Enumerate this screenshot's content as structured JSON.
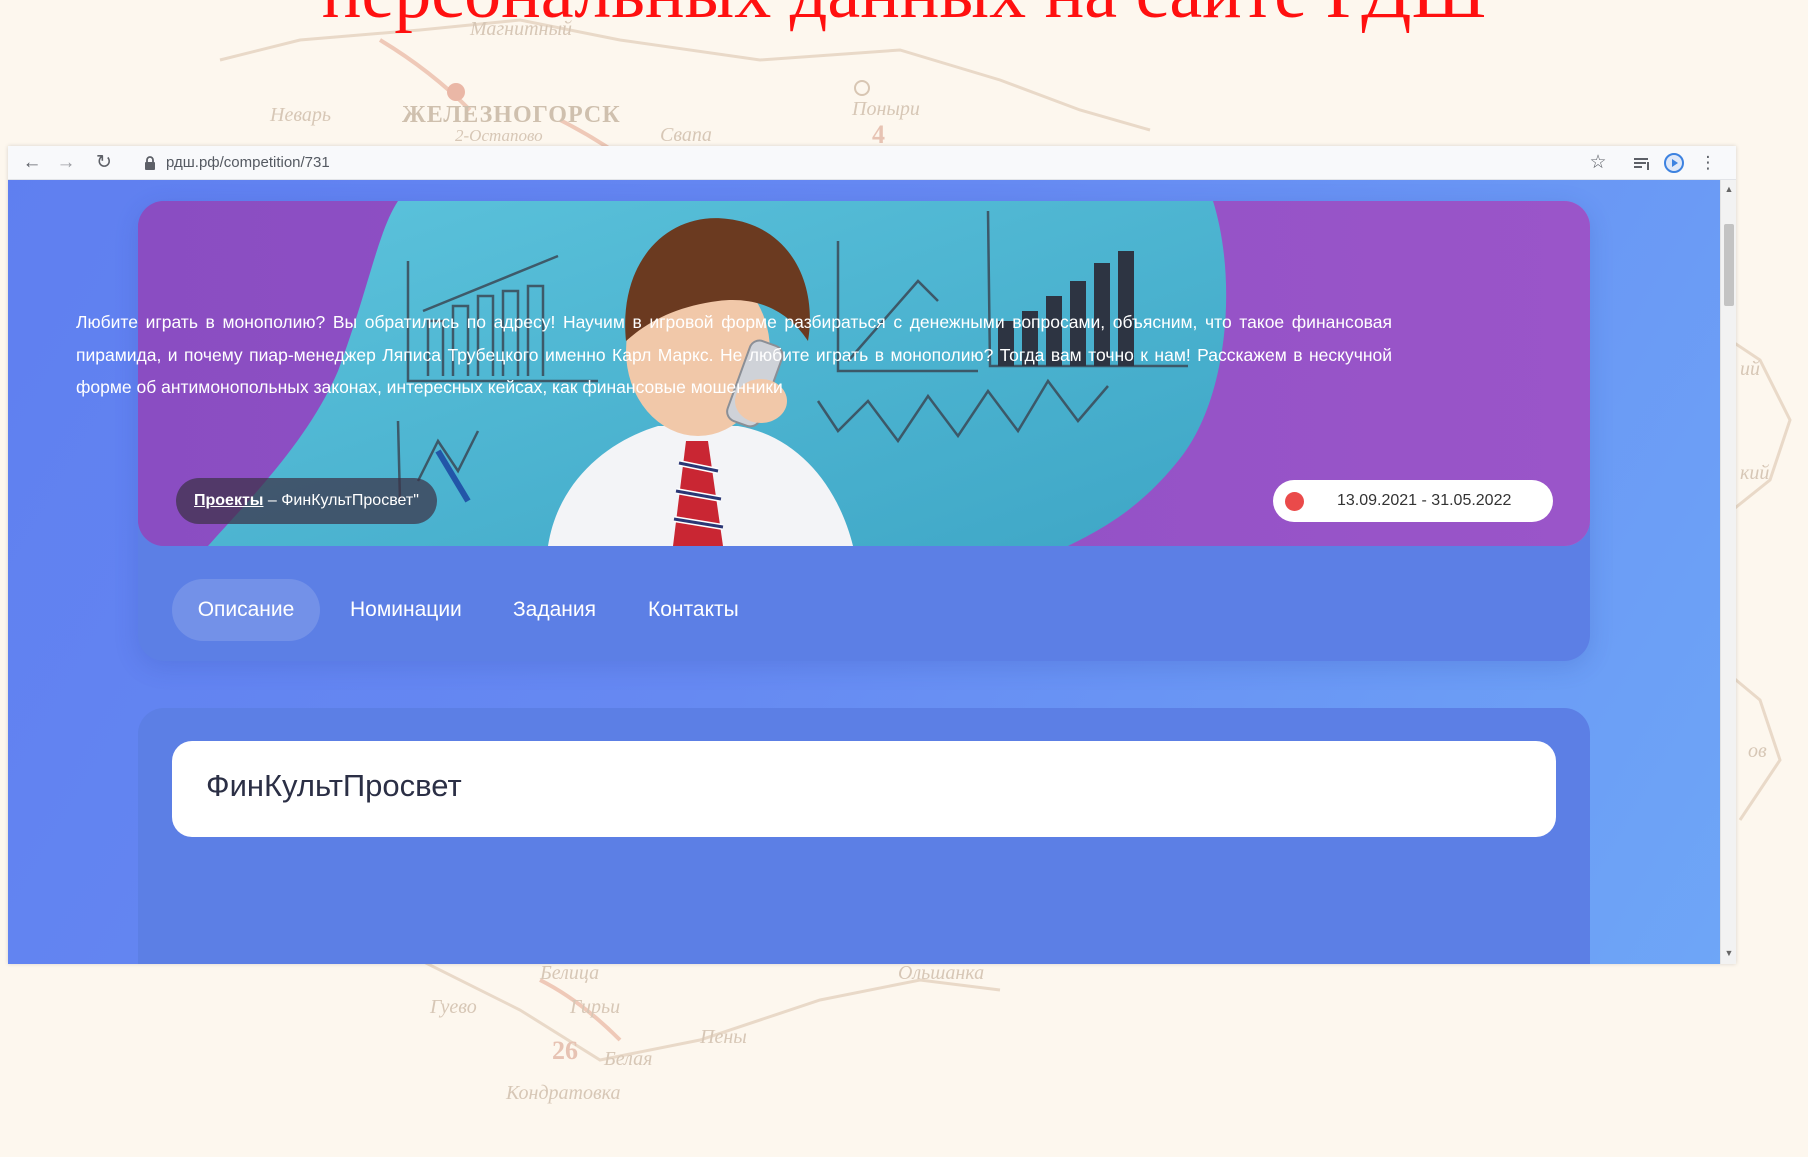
{
  "slide": {
    "title": "персональных данных на сайте РДШ",
    "map_labels": [
      "Магнитный",
      "Неварь",
      "ЖЕЛЕЗНОГОРСК",
      "2-Остапово",
      "Свапа",
      "Поныри",
      "4",
      "Белица",
      "Гуево",
      "Гирьи",
      "Пены",
      "26",
      "Белая",
      "Кондратовка",
      "Ольшанка",
      "ий",
      "кий",
      "ов"
    ]
  },
  "browser": {
    "url": "рдш.рф/competition/731",
    "icons": [
      "back-arrow-icon",
      "forward-arrow-icon",
      "reload-icon",
      "lock-icon",
      "star-icon",
      "reading-list-icon",
      "extension-icon",
      "menu-dots-icon"
    ]
  },
  "header": {
    "breadcrumb": {
      "link": "Проекты",
      "separator": " – ",
      "current": "ФинКультПросвет\""
    },
    "dates": "13.09.2021 - 31.05.2022",
    "status_color": "#ea4a4a",
    "tabs": [
      "Описание",
      "Номинации",
      "Задания",
      "Контакты"
    ],
    "active_tab": "Описание"
  },
  "content": {
    "title": "ФинКультПросвет",
    "description": "Любите играть в монополию? Вы обратились по адресу! Научим в игровой форме разбираться с денежными вопросами, объясним, что такое финансовая пирамида, и почему пиар-менеджер Ляписа Трубецкого именно Карл Маркс. Не любите играть в монополию? Тогда вам точно к нам! Расскажем в нескучной форме об антимонопольных законах, интересных кейсах, как финансовые мошенники"
  },
  "colors": {
    "title_red": "#ff1010",
    "page_blue": "#6689f2",
    "card_blue": "#5c7fe5",
    "banner_purple": "#9150c6",
    "banner_teal": "#4bb3cf"
  }
}
